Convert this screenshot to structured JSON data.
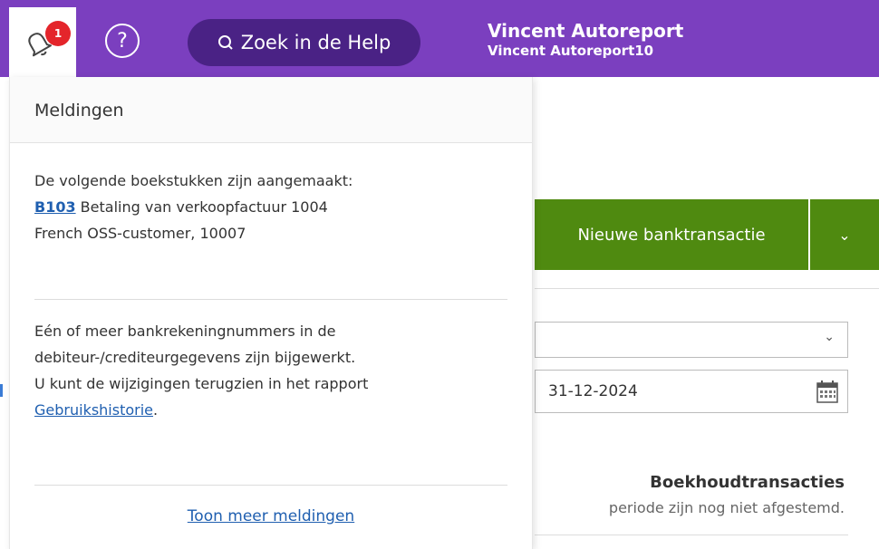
{
  "header": {
    "notification_count": "1",
    "help_search_label": "Zoek in de Help",
    "user_name": "Vincent Autoreport",
    "user_sub": "Vincent Autoreport10",
    "colors": {
      "bar": "#7b3fbf",
      "search": "#4a2285",
      "badge": "#e4252b"
    }
  },
  "notifications": {
    "title": "Meldingen",
    "item1": {
      "line1": "De volgende boekstukken zijn aangemaakt:",
      "link": "B103",
      "text_after_link": " Betaling van verkoopfactuur 1004",
      "line3": "French OSS-customer, 10007"
    },
    "item2": {
      "line1": "Eén of meer bankrekeningnummers in de",
      "line2": "debiteur-/crediteurgegevens zijn bijgewerkt.",
      "line3": "U kunt de wijzigingen terugzien in het rapport",
      "link": "Gebruikshistorie",
      "after_link": "."
    },
    "show_more": "Toon meer meldingen"
  },
  "page": {
    "new_bank_button": "Nieuwe banktransactie",
    "dropdown_chevron": "⌄",
    "date_value": "31-12-2024",
    "boekhoud_title": "Boekhoudtransacties",
    "boekhoud_sub": "periode zijn nog niet afgestemd.",
    "accent_green": "#4f8a10"
  }
}
